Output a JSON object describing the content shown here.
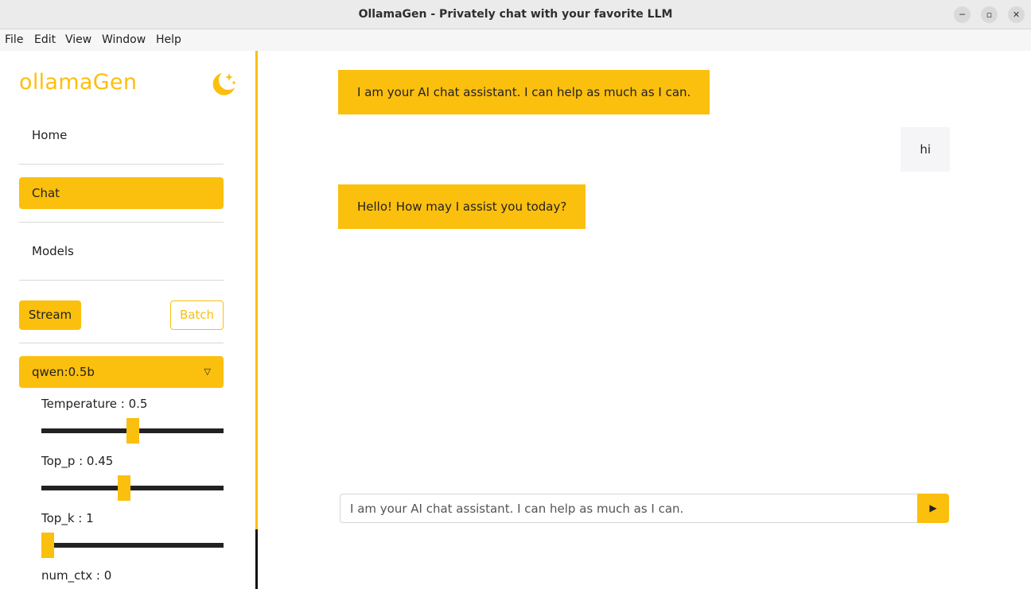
{
  "window": {
    "title": "OllamaGen - Privately chat with your favorite LLM",
    "minimize_glyph": "─",
    "maximize_glyph": "▫",
    "close_glyph": "✕"
  },
  "menubar": {
    "items": [
      "File",
      "Edit",
      "View",
      "Window",
      "Help"
    ]
  },
  "sidebar": {
    "logo": "ollamaGen",
    "theme_icon": "moon-stars-icon",
    "nav": [
      {
        "label": "Home",
        "active": false
      },
      {
        "label": "Chat",
        "active": true
      },
      {
        "label": "Models",
        "active": false
      }
    ],
    "mode": {
      "stream_label": "Stream",
      "batch_label": "Batch",
      "selected": "Stream"
    },
    "model": {
      "selected": "qwen:0.5b",
      "arrow_glyph": "▽"
    },
    "params": [
      {
        "label": "Temperature : 0.5",
        "value": 0.5,
        "min": 0,
        "max": 1
      },
      {
        "label": "Top_p : 0.45",
        "value": 0.45,
        "min": 0,
        "max": 1
      },
      {
        "label": "Top_k : 1",
        "value": 1,
        "min": 1,
        "max": 100
      },
      {
        "label": "num_ctx : 0",
        "value": 0,
        "min": 0,
        "max": 100
      }
    ]
  },
  "chat": {
    "messages": [
      {
        "role": "assistant",
        "text": "I am your AI chat assistant. I can help as much as I can."
      },
      {
        "role": "user",
        "text": "hi"
      },
      {
        "role": "assistant",
        "text": "Hello! How may I assist you today?"
      }
    ],
    "input": {
      "value": "",
      "placeholder": "I am your AI chat assistant. I can help as much as I can."
    },
    "send_glyph": "▶"
  },
  "colors": {
    "accent": "#fbbf0e",
    "user_bubble": "#f5f5f7",
    "slider_track": "#222222"
  }
}
